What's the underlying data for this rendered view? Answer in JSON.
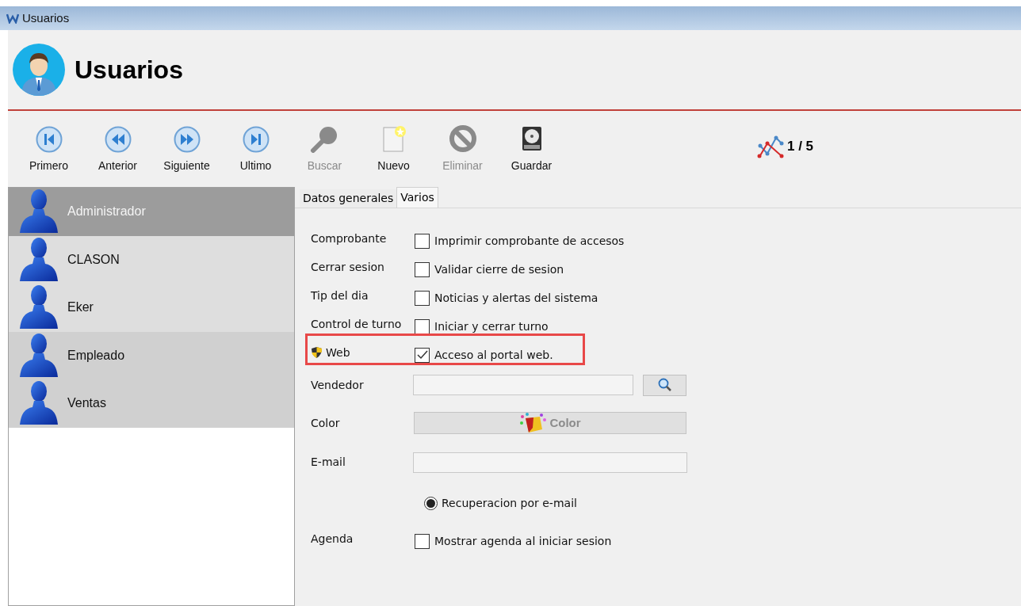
{
  "window": {
    "title": "Usuarios"
  },
  "header": {
    "title": "Usuarios"
  },
  "toolbar": [
    {
      "kind": "first",
      "label": "Primero",
      "disabled": false
    },
    {
      "kind": "previous",
      "label": "Anterior",
      "disabled": false
    },
    {
      "kind": "next",
      "label": "Siguiente",
      "disabled": false
    },
    {
      "kind": "last",
      "label": "Ultimo",
      "disabled": false
    },
    {
      "kind": "search",
      "label": "Buscar",
      "disabled": true
    },
    {
      "kind": "new",
      "label": "Nuevo",
      "disabled": false
    },
    {
      "kind": "delete",
      "label": "Eliminar",
      "disabled": true
    },
    {
      "kind": "save",
      "label": "Guardar",
      "disabled": false
    }
  ],
  "record_counter": "1 / 5",
  "users": [
    {
      "name": "Administrador",
      "selected": true,
      "shaded": true
    },
    {
      "name": "CLASON",
      "selected": false,
      "shaded": false
    },
    {
      "name": "Eker",
      "selected": false,
      "shaded": false
    },
    {
      "name": "Empleado",
      "selected": false,
      "shaded": true
    },
    {
      "name": "Ventas",
      "selected": false,
      "shaded": true
    }
  ],
  "tabs": [
    {
      "label": "Datos generales",
      "selected": false
    },
    {
      "label": "Varios",
      "selected": true
    }
  ],
  "form": [
    {
      "kind": "checkbox",
      "label": "Comprobante",
      "text": "Imprimir comprobante de accesos",
      "checked": false,
      "highlighted": false
    },
    {
      "kind": "checkbox",
      "label": "Cerrar sesion",
      "text": "Validar cierre de sesion",
      "checked": false,
      "highlighted": false
    },
    {
      "kind": "checkbox",
      "label": "Tip del dia",
      "text": "Noticias y alertas del sistema",
      "checked": false,
      "highlighted": false
    },
    {
      "kind": "checkbox",
      "label": "Control de turno",
      "text": "Iniciar y cerrar turno",
      "checked": false,
      "highlighted": false
    },
    {
      "kind": "checkbox",
      "label": "Web",
      "text": "Acceso al portal web.",
      "checked": true,
      "highlighted": true,
      "shield": true
    },
    {
      "kind": "lookup",
      "label": "Vendedor"
    },
    {
      "kind": "color",
      "label": "Color",
      "text": "Color"
    },
    {
      "kind": "field",
      "label": "E-mail"
    },
    {
      "kind": "radio",
      "text": "Recuperacion por e-mail",
      "checked": true
    },
    {
      "kind": "checkbox",
      "label": "Agenda",
      "text": "Mostrar agenda al iniciar sesion",
      "checked": false,
      "highlighted": false
    }
  ]
}
